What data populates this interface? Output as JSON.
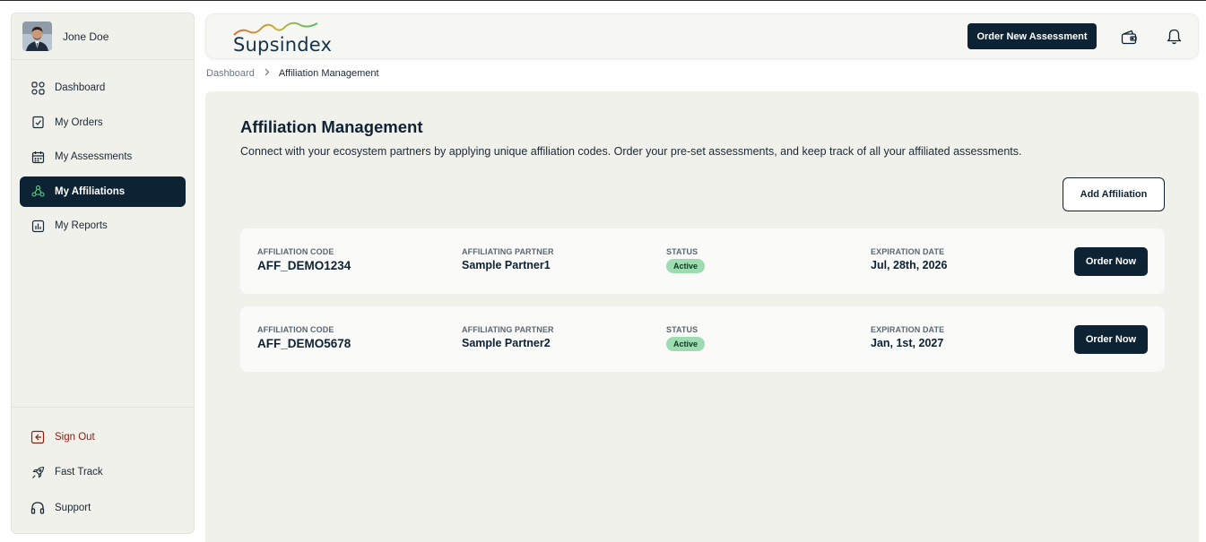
{
  "user": {
    "name": "Jone Doe"
  },
  "sidebar": {
    "items": [
      {
        "label": "Dashboard",
        "icon": "dashboard-grid-icon"
      },
      {
        "label": "My Orders",
        "icon": "orders-clipboard-icon"
      },
      {
        "label": "My Assessments",
        "icon": "calendar-icon"
      },
      {
        "label": "My Affiliations",
        "icon": "affiliations-network-icon",
        "active": true
      },
      {
        "label": "My Reports",
        "icon": "reports-chart-icon"
      }
    ],
    "bottom_items": [
      {
        "label": "Sign Out",
        "icon": "sign-out-icon"
      },
      {
        "label": "Fast Track",
        "icon": "rocket-icon"
      },
      {
        "label": "Support",
        "icon": "headset-icon"
      }
    ]
  },
  "header": {
    "logo_text": "Supsindex",
    "order_button": "Order New Assessment",
    "icons": [
      "wallet-icon",
      "bell-icon"
    ]
  },
  "breadcrumb": {
    "root": "Dashboard",
    "current": "Affiliation Management"
  },
  "page": {
    "title": "Affiliation Management",
    "subtitle": "Connect with your ecosystem partners by applying unique affiliation codes. Order your pre-set assessments, and keep track of all your affiliated assessments.",
    "add_button": "Add Affiliation"
  },
  "columns": {
    "code": "AFFILIATION CODE",
    "partner": "AFFILIATING PARTNER",
    "status": "STATUS",
    "expiration": "EXPIRATION DATE"
  },
  "affiliations": [
    {
      "code": "AFF_DEMO1234",
      "partner": "Sample Partner1",
      "status": "Active",
      "expiration": "Jul, 28th, 2026",
      "action": "Order Now"
    },
    {
      "code": "AFF_DEMO5678",
      "partner": "Sample Partner2",
      "status": "Active",
      "expiration": "Jan, 1st, 2027",
      "action": "Order Now"
    }
  ],
  "colors": {
    "primary": "#0d2233",
    "background": "#f1f1ec",
    "status_active": "#9ddcb0",
    "signout": "#8a1f14"
  }
}
